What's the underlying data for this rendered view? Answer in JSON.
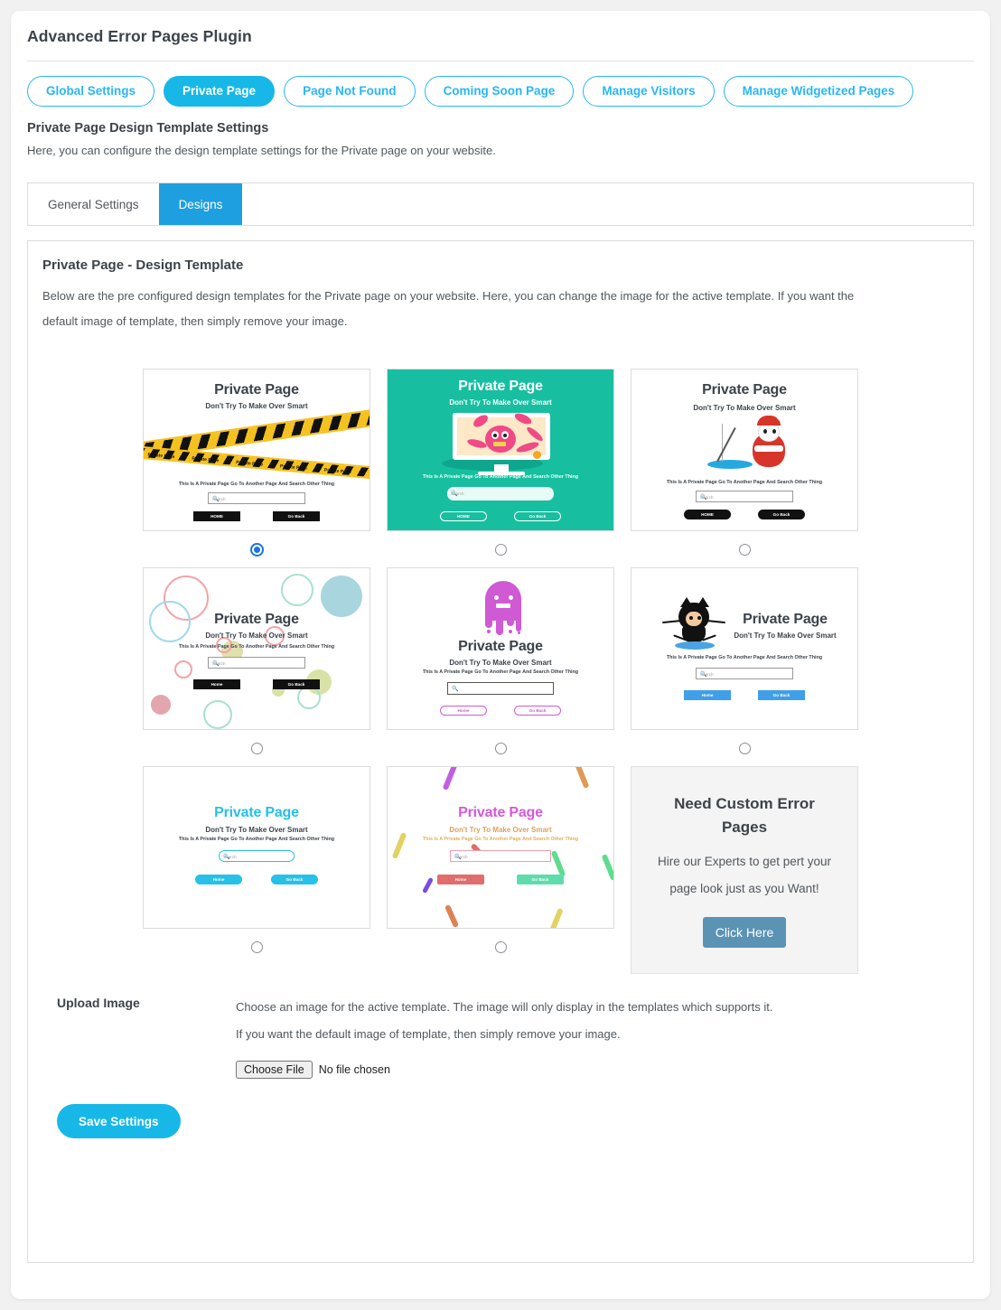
{
  "header": {
    "plugin_title": "Advanced Error Pages Plugin"
  },
  "main_tabs": [
    {
      "label": "Global Settings",
      "active": false
    },
    {
      "label": "Private Page",
      "active": true
    },
    {
      "label": "Page Not Found",
      "active": false
    },
    {
      "label": "Coming Soon Page",
      "active": false
    },
    {
      "label": "Manage Visitors",
      "active": false
    },
    {
      "label": "Manage Widgetized Pages",
      "active": false
    }
  ],
  "section": {
    "title": "Private Page Design Template Settings",
    "description": "Here, you can configure the design template settings for the Private page on your website."
  },
  "sub_tabs": [
    {
      "label": "General Settings",
      "active": false
    },
    {
      "label": "Designs",
      "active": true
    }
  ],
  "panel": {
    "title": "Private Page - Design Template",
    "description_line1": "Below are the pre configured design templates for the Private page on your website. Here, you can change the image for the active template. If you want the",
    "description_line2": "default image of template, then simply remove your image."
  },
  "template_common": {
    "heading": "Private Page",
    "subheading": "Don't Try To Make Over Smart",
    "body_text": "This Is A Private Page Go To Another Page And Search Other Thing",
    "search_placeholder": "Search",
    "search_icon": "magnifier-icon",
    "tape_label": "Private Page"
  },
  "templates": [
    {
      "id": "caution-tape",
      "selected": true,
      "home_label": "HOME",
      "back_label": "Go Back"
    },
    {
      "id": "teal-monster",
      "selected": false,
      "home_label": "HOME",
      "back_label": "Go Back"
    },
    {
      "id": "panda-fishing",
      "selected": false,
      "home_label": "HOME",
      "back_label": "Go Back"
    },
    {
      "id": "pastel-circles",
      "selected": false,
      "home_label": "Home",
      "back_label": "Go Back"
    },
    {
      "id": "melting-ghost",
      "selected": false,
      "home_label": "Home",
      "back_label": "Go Back"
    },
    {
      "id": "github-octocat",
      "selected": false,
      "home_label": "Home",
      "back_label": "Go Back"
    },
    {
      "id": "cyan-minimal",
      "selected": false,
      "home_label": "Home",
      "back_label": "Go Back"
    },
    {
      "id": "confetti",
      "selected": false,
      "home_label": "Home",
      "back_label": "Go Back"
    }
  ],
  "promo": {
    "title": "Need Custom Error Pages",
    "line1": "Hire our Experts to get pert your",
    "line2": "page look just as you Want!",
    "button_label": "Click Here"
  },
  "upload": {
    "label": "Upload Image",
    "line1": "Choose an image for the active template. The image will only display in the templates which supports it.",
    "line2": "If you want the default image of template, then simply remove your image.",
    "choose_file_label": "Choose File",
    "file_status": "No file chosen"
  },
  "footer": {
    "save_label": "Save Settings"
  },
  "colors": {
    "accent": "#17b8e8",
    "tab_border": "#29b6f6",
    "subtab_active": "#1e9fe0",
    "radio_checked": "#1a73e8",
    "teal": "#17bfa0",
    "promo_button": "#5b93b5"
  }
}
